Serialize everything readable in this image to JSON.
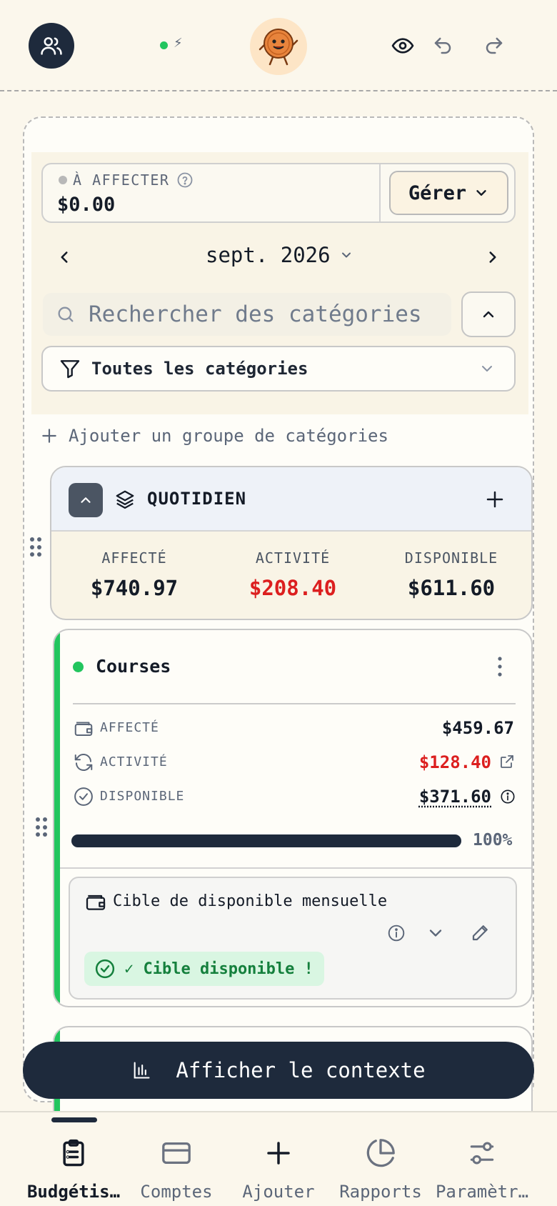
{
  "topbar": {
    "status_symbol": "⚡",
    "icons": [
      "users-icon",
      "mascot-icon",
      "eye-icon",
      "undo-icon",
      "redo-icon"
    ]
  },
  "assign": {
    "label": "À AFFECTER",
    "value": "$0.00",
    "manage_label": "Gérer"
  },
  "month": {
    "label": "sept. 2026"
  },
  "search": {
    "placeholder": "Rechercher des catégories"
  },
  "filter": {
    "label": "Toutes les catégories"
  },
  "add_group_label": "Ajouter un groupe de catégories",
  "group": {
    "title": "QUOTIDIEN",
    "stats": [
      {
        "label": "AFFECTÉ",
        "value": "$740.97",
        "color": "#141b27"
      },
      {
        "label": "ACTIVITÉ",
        "value": "$208.40",
        "color": "#dc1f1f"
      },
      {
        "label": "DISPONIBLE",
        "value": "$611.60",
        "color": "#141b27"
      }
    ]
  },
  "category": {
    "title": "Courses",
    "accent_color": "#22c55e",
    "rows": [
      {
        "label": "AFFECTÉ",
        "value": "$459.67",
        "color": "#141b27"
      },
      {
        "label": "ACTIVITÉ",
        "value": "$128.40",
        "color": "#dc1f1f"
      },
      {
        "label": "DISPONIBLE",
        "value": "$371.60",
        "color": "#141b27"
      }
    ],
    "progress_percent": 100,
    "progress_label": "100%",
    "target": {
      "title": "Cible de disponible mensuelle",
      "badge": "✓ Cible disponible !"
    }
  },
  "context_button": {
    "label": "Afficher le contexte"
  },
  "nav": [
    {
      "label": "Budgétis…",
      "icon": "clipboard-icon",
      "active": true
    },
    {
      "label": "Comptes",
      "icon": "card-icon",
      "active": false
    },
    {
      "label": "Ajouter",
      "icon": "plus-icon",
      "active": false
    },
    {
      "label": "Rapports",
      "icon": "pie-chart-icon",
      "active": false
    },
    {
      "label": "Paramètr…",
      "icon": "sliders-icon",
      "active": false
    }
  ]
}
